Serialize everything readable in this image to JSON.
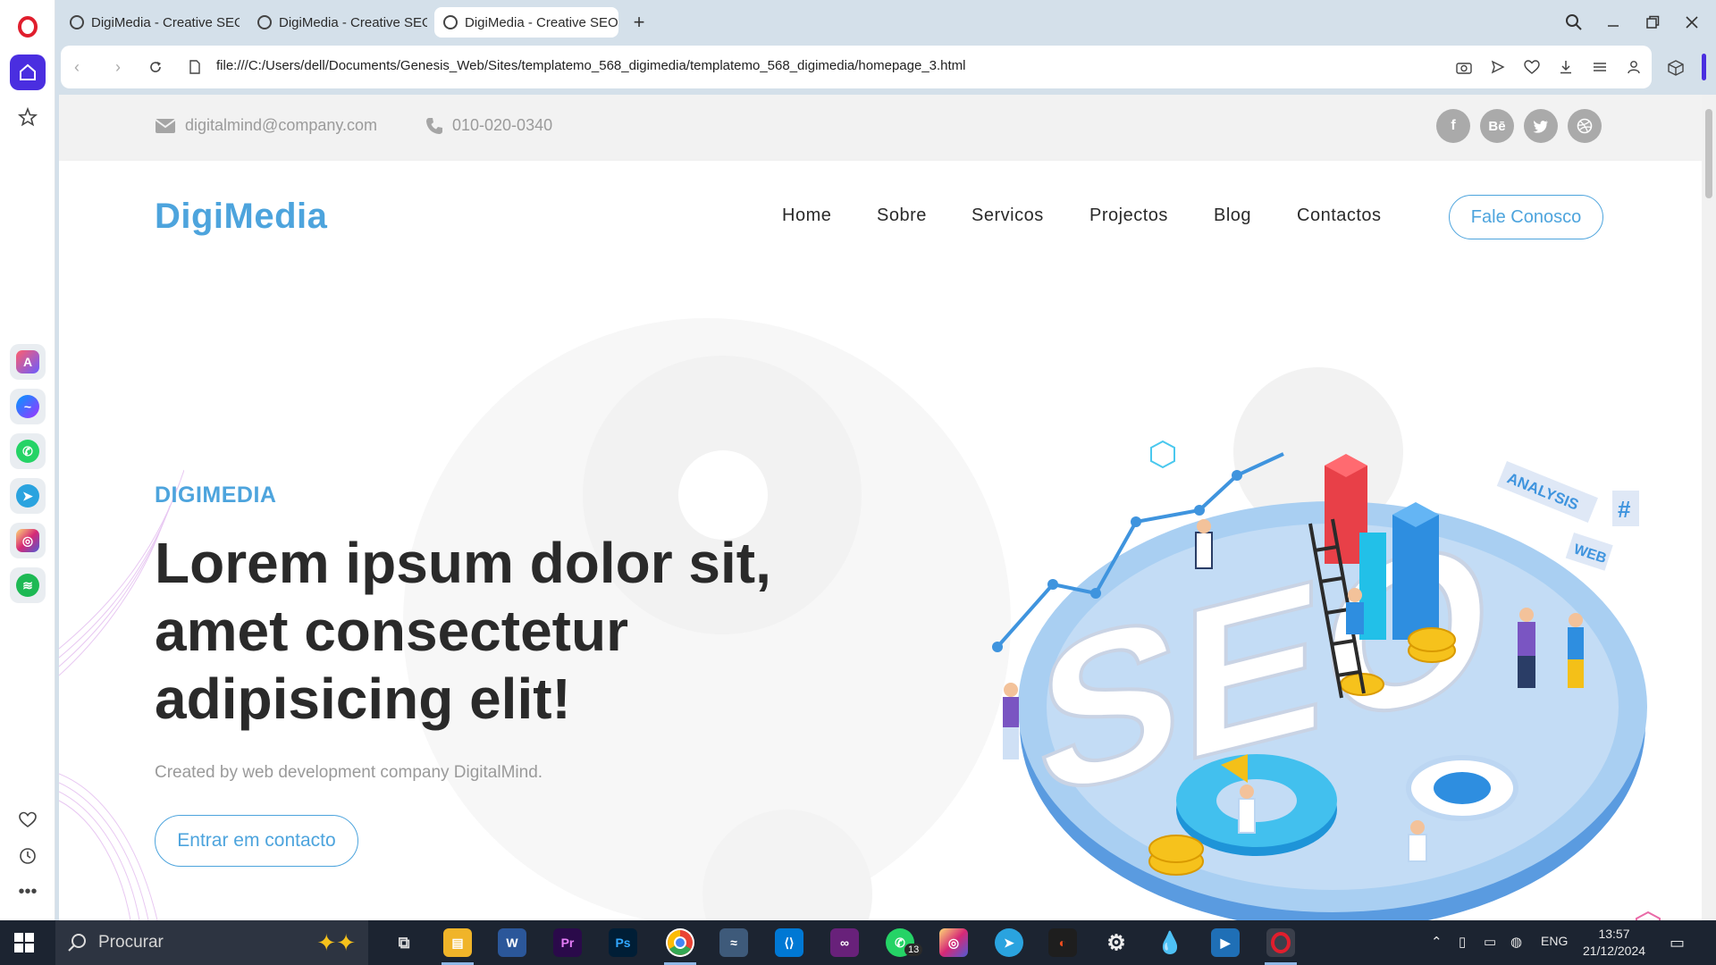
{
  "browser": {
    "tabs": [
      {
        "label": "DigiMedia - Creative SEO",
        "active": false
      },
      {
        "label": "DigiMedia - Creative SEO",
        "active": false
      },
      {
        "label": "DigiMedia - Creative SEO",
        "active": true
      }
    ],
    "url": "file:///C:/Users/dell/Documents/Genesis_Web/Sites/templatemo_568_digimedia/templatemo_568_digimedia/homepage_3.html",
    "accent": "#4a2ee0"
  },
  "page": {
    "topbar": {
      "email": "digitalmind@company.com",
      "phone": "010-020-0340",
      "social": [
        {
          "icon": "facebook-icon",
          "glyph": "f"
        },
        {
          "icon": "behance-icon",
          "glyph": "Bē"
        },
        {
          "icon": "twitter-icon",
          "glyph": "🐦"
        },
        {
          "icon": "dribbble-icon",
          "glyph": "⊛"
        }
      ]
    },
    "header": {
      "logo": "DigiMedia",
      "nav": [
        "Home",
        "Sobre",
        "Servicos",
        "Projectos",
        "Blog",
        "Contactos"
      ],
      "cta": "Fale Conosco"
    },
    "hero": {
      "kicker": "DIGIMEDIA",
      "title": "Lorem ipsum dolor sit, amet consectetur adipisicing elit!",
      "subtitle": "Created by web development company DigitalMind.",
      "cta": "Entrar em contacto",
      "illustration": {
        "words": [
          "SEO"
        ],
        "tags": [
          "ANALYSIS",
          "WEB",
          "#"
        ]
      }
    },
    "brand_color": "#4da4dd"
  },
  "taskbar": {
    "search_placeholder": "Procurar",
    "whatsapp_badge": "13",
    "language": "ENG",
    "time": "13:57",
    "date": "21/12/2024"
  }
}
